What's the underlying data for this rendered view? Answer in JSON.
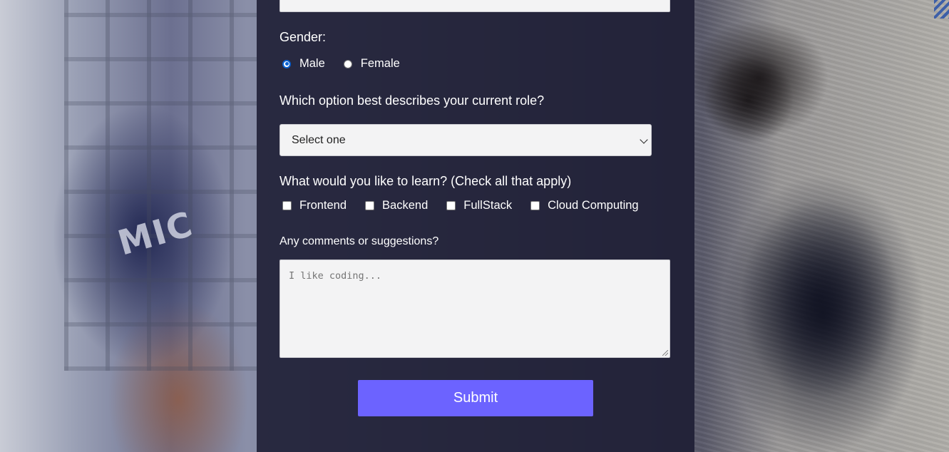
{
  "form": {
    "gender": {
      "label": "Gender:",
      "options": [
        {
          "label": "Male",
          "checked": true
        },
        {
          "label": "Female",
          "checked": false
        }
      ]
    },
    "role": {
      "label": "Which option best describes your current role?",
      "selected": "Select one"
    },
    "learn": {
      "label": "What would you like to learn? (Check all that apply)",
      "options": [
        {
          "label": "Frontend",
          "checked": false
        },
        {
          "label": "Backend",
          "checked": false
        },
        {
          "label": "FullStack",
          "checked": false
        },
        {
          "label": "Cloud Computing",
          "checked": false
        }
      ]
    },
    "comments": {
      "label": "Any comments or suggestions?",
      "placeholder": "I like coding..."
    },
    "submit_label": "Submit"
  },
  "colors": {
    "panel": "#1b1b32",
    "submit": "#6c63ff",
    "input_bg": "#f3f3f4"
  }
}
